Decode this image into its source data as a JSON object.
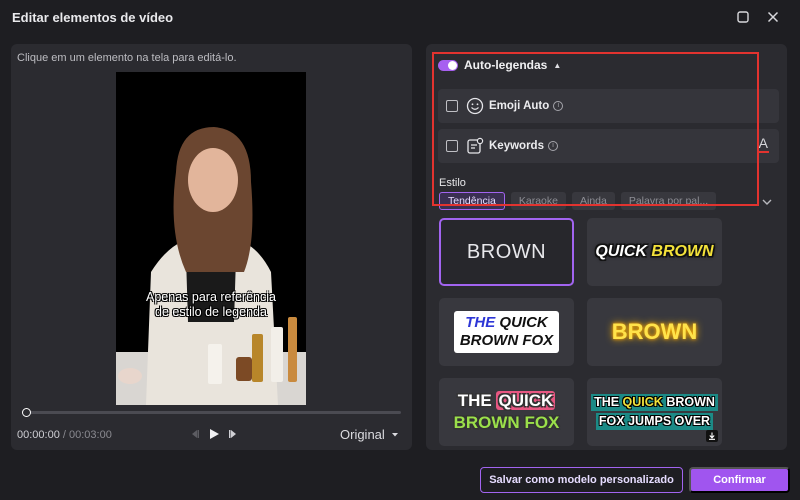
{
  "window": {
    "title": "Editar elementos de vídeo",
    "maximize_icon": "maximize-icon",
    "close_icon": "close-icon"
  },
  "preview": {
    "hint": "Clique em um elemento na tela para editá-lo.",
    "subtitle_line1": "Apenas para referência",
    "subtitle_line2": "de estilo de legenda",
    "current_time": "00:00:00",
    "separator": " / ",
    "total_time": "00:03:00",
    "progress": 0.0,
    "ratio_label": "Original"
  },
  "auto_captions": {
    "label": "Auto-legendas",
    "enabled": true,
    "options": [
      {
        "label": "Emoji Auto",
        "checked": false,
        "icon": "emoji-icon"
      },
      {
        "label": "Keywords",
        "checked": false,
        "icon": "keywords-icon"
      }
    ],
    "font_icon_label": "A"
  },
  "style": {
    "label": "Estilo",
    "tabs": [
      "Tendência",
      "Karaoke",
      "Ainda",
      "Palavra por pal..."
    ],
    "active_tab": "Tendência",
    "presets": [
      {
        "text": "BROWN"
      },
      {
        "word1": "QUICK",
        "word2": "BROWN"
      },
      {
        "line1_a": "THE",
        "line1_b": "QUICK",
        "line2": "BROWN FOX"
      },
      {
        "text": "BROWN"
      },
      {
        "line1_a": "THE",
        "line1_b": "QUICK",
        "line2_a": "BROWN",
        "line2_b": "FOX"
      },
      {
        "line1_a": "THE",
        "line1_b": "QUICK",
        "line1_c": "BROWN",
        "line2": "FOX JUMPS OVER"
      }
    ],
    "accent_color": "#a264f0"
  },
  "footer": {
    "save_template_label": "Salvar como modelo personalizado",
    "confirm_label": "Confirmar"
  }
}
